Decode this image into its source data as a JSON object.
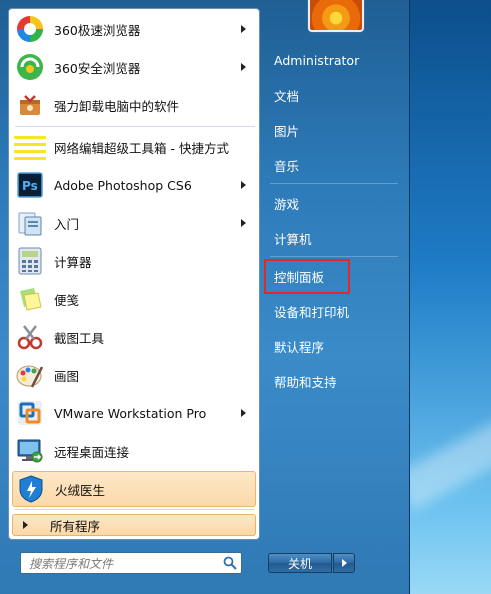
{
  "programs": [
    {
      "label": "360极速浏览器",
      "icon": "360-speed-browser-icon",
      "submenu": true
    },
    {
      "label": "360安全浏览器",
      "icon": "360-safe-browser-icon",
      "submenu": true
    },
    {
      "label": "强力卸载电脑中的软件",
      "icon": "uninstall-icon",
      "submenu": false
    },
    {
      "label": "网络编辑超级工具箱 - 快捷方式",
      "icon": "toolbox-icon",
      "submenu": false
    },
    {
      "label": "Adobe Photoshop CS6",
      "icon": "photoshop-icon",
      "submenu": true
    },
    {
      "label": "入门",
      "icon": "getting-started-icon",
      "submenu": true
    },
    {
      "label": "计算器",
      "icon": "calculator-icon",
      "submenu": false
    },
    {
      "label": "便笺",
      "icon": "sticky-notes-icon",
      "submenu": false
    },
    {
      "label": "截图工具",
      "icon": "snipping-tool-icon",
      "submenu": false
    },
    {
      "label": "画图",
      "icon": "paint-icon",
      "submenu": false
    },
    {
      "label": "VMware Workstation Pro",
      "icon": "vmware-icon",
      "submenu": true
    },
    {
      "label": "远程桌面连接",
      "icon": "remote-desktop-icon",
      "submenu": false
    },
    {
      "label": "火绒医生",
      "icon": "huorong-shield-icon",
      "submenu": false
    }
  ],
  "all_programs": "所有程序",
  "search": {
    "placeholder": "搜索程序和文件"
  },
  "right_pane": {
    "user": "Administrator",
    "documents": "文档",
    "pictures": "图片",
    "music": "音乐",
    "games": "游戏",
    "computer": "计算机",
    "control_panel": "控制面板",
    "devices": "设备和打印机",
    "default_programs": "默认程序",
    "help": "帮助和支持"
  },
  "shutdown": {
    "label": "关机"
  },
  "colors": {
    "highlight_border": "#e1292b",
    "menu_blue": "#2d7ab8",
    "hover_orange": "#fbd9a8"
  }
}
